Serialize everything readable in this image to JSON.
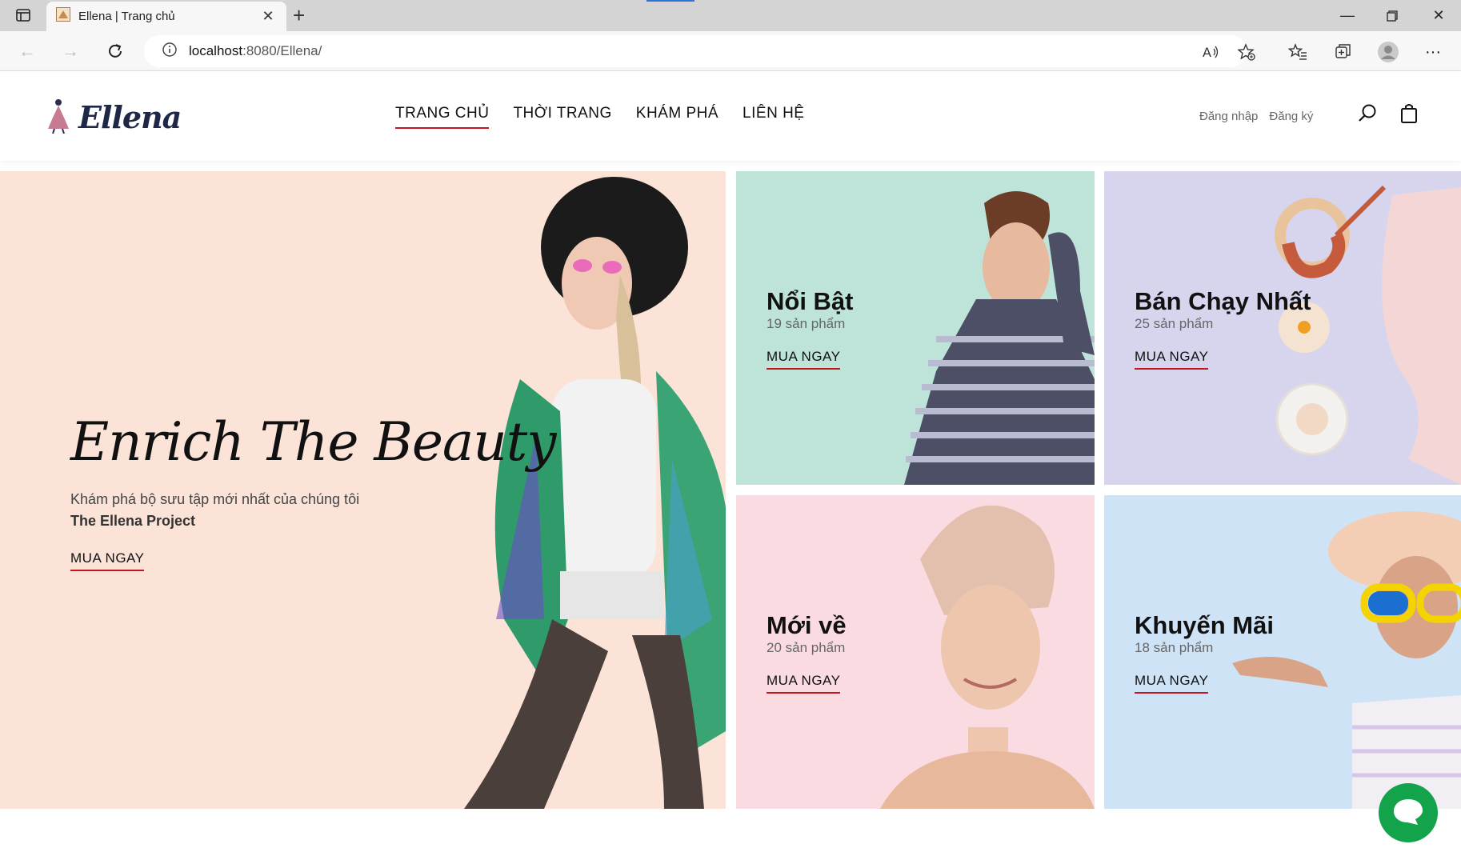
{
  "browser": {
    "tab_title": "Ellena | Trang chủ",
    "url_host": "localhost",
    "url_rest": ":8080/Ellena/"
  },
  "site": {
    "logo_text": "Ellena",
    "nav": [
      {
        "label": "TRANG CHỦ",
        "active": true
      },
      {
        "label": "THỜI TRANG",
        "active": false
      },
      {
        "label": "KHÁM PHÁ",
        "active": false
      },
      {
        "label": "LIÊN HỆ",
        "active": false
      }
    ],
    "login": "Đăng nhập",
    "register": "Đăng ký"
  },
  "hero": {
    "title": "Enrich The Beauty",
    "subtitle": "Khám phá bộ sưu tập mới nhất của chúng tôi",
    "brand": "The Ellena Project",
    "cta": "MUA NGAY"
  },
  "cards": [
    {
      "title": "Nổi Bật",
      "count": "19 sản phẩm",
      "cta": "MUA NGAY",
      "bg": "#bee3d9"
    },
    {
      "title": "Bán Chạy Nhất",
      "count": "25 sản phẩm",
      "cta": "MUA NGAY",
      "bg": "#d7d5ee"
    },
    {
      "title": "Mới về",
      "count": "20 sản phẩm",
      "cta": "MUA NGAY",
      "bg": "#fadbe1"
    },
    {
      "title": "Khuyến Mãi",
      "count": "18 sản phẩm",
      "cta": "MUA NGAY",
      "bg": "#cfe3f6"
    }
  ],
  "colors": {
    "accent": "#c4161c",
    "chat": "#13a34b",
    "hero_bg": "#fbe3d8"
  }
}
